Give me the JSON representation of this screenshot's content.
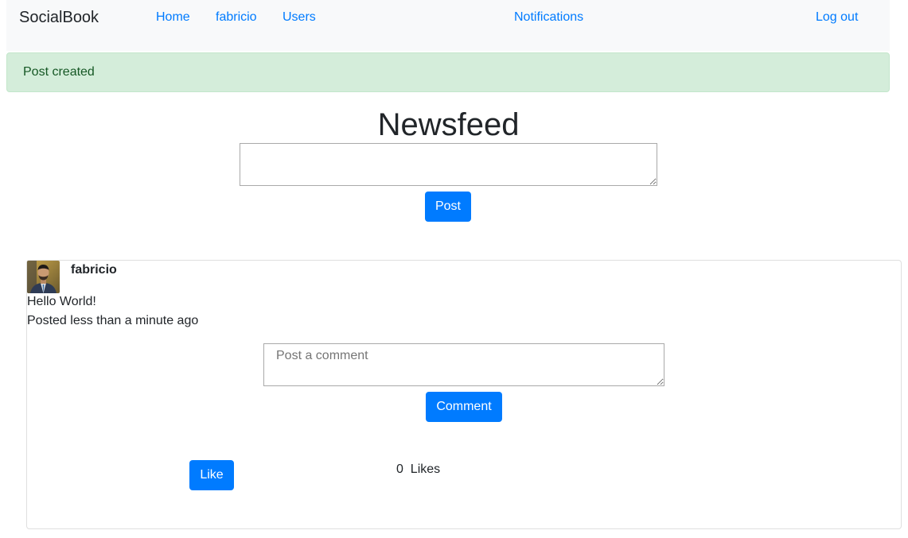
{
  "navbar": {
    "brand": "SocialBook",
    "links": [
      "Home",
      "fabricio",
      "Users",
      "Notifications",
      "Log out"
    ]
  },
  "alert": {
    "message": "Post created"
  },
  "page": {
    "title": "Newsfeed"
  },
  "composer": {
    "value": "",
    "button_label": "Post"
  },
  "post": {
    "author": "fabricio",
    "body": "Hello World!",
    "timestamp": "Posted less than a minute ago",
    "comment": {
      "placeholder": "Post a comment",
      "value": "",
      "button_label": "Comment"
    },
    "like_button_label": "Like",
    "likes_count": "0",
    "likes_label": "Likes"
  },
  "colors": {
    "primary": "#007bff",
    "navbar_bg": "#f8f9fa",
    "alert_bg": "#d4edda",
    "alert_text": "#155724"
  }
}
